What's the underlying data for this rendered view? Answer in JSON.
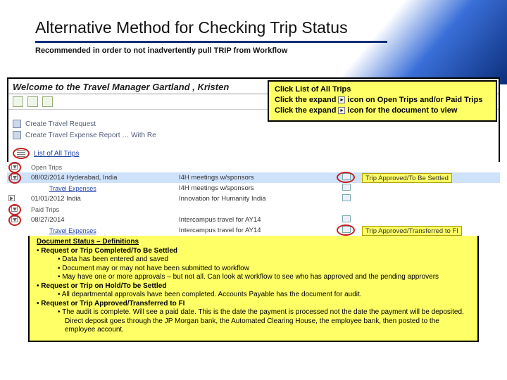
{
  "title": "Alternative Method for Checking Trip Status",
  "subtitle": "Recommended in order to not inadvertently pull TRIP from Workflow",
  "app": {
    "welcome": "Welcome to the Travel Manager Gartland , Kristen",
    "nav": {
      "create_request": "Create Travel Request",
      "create_expense": "Create Travel Expense Report … With Re",
      "list_all": "List of All Trips"
    }
  },
  "callout": {
    "l1": "Click List of All Trips",
    "l2a": "Click the expand ",
    "l2b": " icon on Open Trips and/or Paid Trips",
    "l3a": "Click the expand ",
    "l3b": " icon for the document to view"
  },
  "table": {
    "groups": {
      "open": "Open Trips",
      "paid": "Paid Trips"
    },
    "rows": [
      {
        "date": "08/02/2014 Hyderabad, India",
        "reason": "I4H meetings w/sponsors",
        "status": "Trip Approved/To Be Settled"
      },
      {
        "sub": "Travel Expenses",
        "reason": "I4H meetings w/sponsors"
      },
      {
        "date": "01/01/2012 India",
        "reason": "Innovation for Humanity India"
      },
      {
        "date": "08/27/2014",
        "reason": "Intercampus travel for AY14"
      },
      {
        "sub": "Travel Expenses",
        "reason": "Intercampus travel for AY14",
        "status": "Trip Approved/Transferred to FI"
      }
    ]
  },
  "defs": {
    "header": "Document Status – Definitions",
    "s1": "Request or Trip Completed/To Be Settled",
    "s1a": "Data has been entered and saved",
    "s1b": "Document may or may not have been submitted to workflow",
    "s1c": "May have one or more approvals – but not all.  Can look at workflow to see who has approved and the pending approvers",
    "s2": "Request or Trip on Hold/To be Settled",
    "s2a": "All departmental approvals have been completed.  Accounts Payable has the document for audit.",
    "s3": "Request or Trip Approved/Transferred to FI",
    "s3a": "The audit is complete.  Will see a paid date. This is the date the payment is processed not the date the payment will be deposited.  Direct deposit goes through the JP Morgan bank, the Automated Clearing House, the employee bank, then posted to the employee account."
  }
}
